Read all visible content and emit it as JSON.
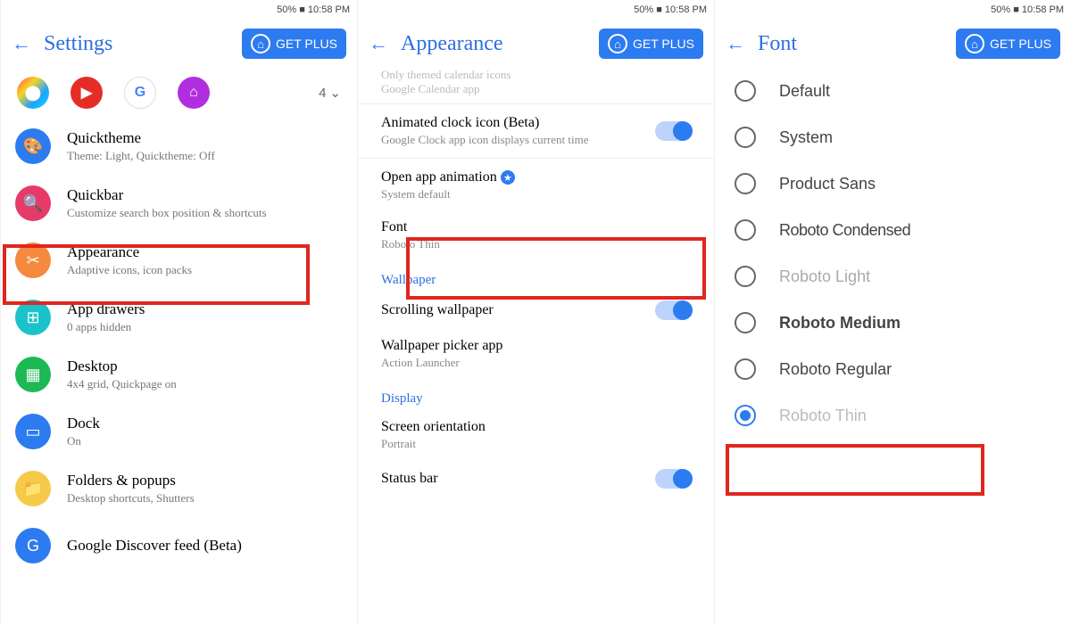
{
  "statusbar": "50% ■ 10:58 PM",
  "header": {
    "settings": "Settings",
    "appearance": "Appearance",
    "font": "Font",
    "getplus": "GET PLUS"
  },
  "col1": {
    "dropdown_count": "4",
    "items": [
      {
        "title": "Quicktheme",
        "sub": "Theme: Light, Quicktheme: Off",
        "color": "#2d7bf0",
        "glyph": "🎨"
      },
      {
        "title": "Quickbar",
        "sub": "Customize search box position & shortcuts",
        "color": "#e63b6a",
        "glyph": "🔍"
      },
      {
        "title": "Appearance",
        "sub": "Adaptive icons, icon packs",
        "color": "#f5893f",
        "glyph": "✂"
      },
      {
        "title": "App drawers",
        "sub": "0 apps hidden",
        "color": "#19c3c9",
        "glyph": "⊞"
      },
      {
        "title": "Desktop",
        "sub": "4x4 grid, Quickpage on",
        "color": "#1db954",
        "glyph": "▦"
      },
      {
        "title": "Dock",
        "sub": "On",
        "color": "#2d7bf0",
        "glyph": "▭"
      },
      {
        "title": "Folders & popups",
        "sub": "Desktop shortcuts, Shutters",
        "color": "#f7c948",
        "glyph": "📁"
      },
      {
        "title": "Google Discover feed (Beta)",
        "sub": "",
        "color": "#2d7bf0",
        "glyph": "G"
      }
    ]
  },
  "col2": {
    "faded1": "Only themed calendar icons",
    "faded2": "Google Calendar app",
    "animclock_t": "Animated clock icon (Beta)",
    "animclock_s": "Google Clock app icon displays current time",
    "openapp_t": "Open app animation",
    "openapp_s": "System default",
    "font_t": "Font",
    "font_s": "Roboto Thin",
    "section_wallpaper": "Wallpaper",
    "scrollwp_t": "Scrolling wallpaper",
    "wppicker_t": "Wallpaper picker app",
    "wppicker_s": "Action Launcher",
    "section_display": "Display",
    "screenori_t": "Screen orientation",
    "screenori_s": "Portrait",
    "statusbar_t": "Status bar"
  },
  "col3": {
    "options": [
      {
        "label": "Default",
        "cls": ""
      },
      {
        "label": "System",
        "cls": ""
      },
      {
        "label": "Product Sans",
        "cls": ""
      },
      {
        "label": "Roboto Condensed",
        "cls": "condensed"
      },
      {
        "label": "Roboto Light",
        "cls": "light"
      },
      {
        "label": "Roboto Medium",
        "cls": "medium"
      },
      {
        "label": "Roboto Regular",
        "cls": ""
      },
      {
        "label": "Roboto Thin",
        "cls": "thin"
      }
    ],
    "selected_index": 7
  }
}
